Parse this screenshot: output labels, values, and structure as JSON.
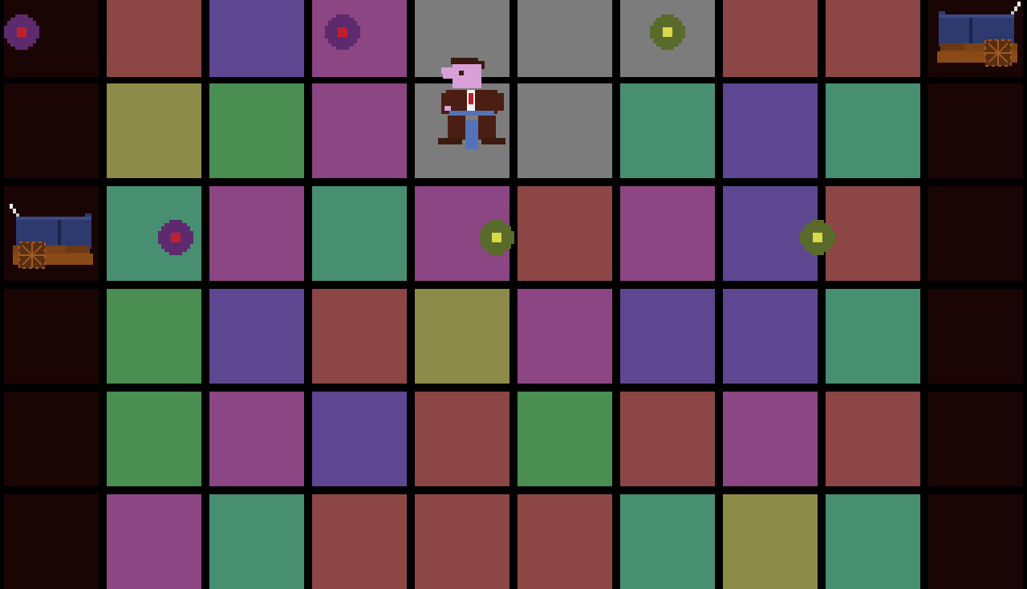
{
  "palette": {
    "R": "#8c4646",
    "P": "#5e4791",
    "M": "#8b4683",
    "Y": "#8d8b4a",
    "G": "#4a8e51",
    "T": "#488f72",
    "X": "#7c7c7c",
    "D": "#1a0505",
    "background": "#000000"
  },
  "grid": {
    "rows": [
      [
        "D",
        "R",
        "P",
        "M",
        "X",
        "X",
        "X",
        "R",
        "R",
        "D"
      ],
      [
        "D",
        "Y",
        "G",
        "M",
        "X",
        "X",
        "T",
        "P",
        "T",
        "D"
      ],
      [
        "D",
        "T",
        "M",
        "T",
        "M",
        "R",
        "M",
        "P",
        "R",
        "D"
      ],
      [
        "D",
        "G",
        "P",
        "R",
        "Y",
        "M",
        "P",
        "P",
        "T",
        "D"
      ],
      [
        "D",
        "G",
        "M",
        "P",
        "R",
        "G",
        "R",
        "M",
        "R",
        "D"
      ],
      [
        "D",
        "M",
        "T",
        "R",
        "R",
        "R",
        "T",
        "Y",
        "T",
        "D"
      ]
    ]
  },
  "targets": [
    {
      "row": 0,
      "col": 0,
      "ring": "#5e2a6e",
      "center": "#c0202e"
    },
    {
      "row": 0,
      "col": 3,
      "ring": "#5e2a6e",
      "center": "#c0202e"
    },
    {
      "row": 0,
      "col": 6,
      "ring": "#5a6a2a",
      "center": "#d8d84a"
    },
    {
      "row": 2,
      "col": 1,
      "ring": "#5e2a6e",
      "center": "#c0202e"
    },
    {
      "row": 2,
      "col": 4,
      "ring": "#5a6a2a",
      "center": "#d8d84a"
    },
    {
      "row": 2,
      "col": 7,
      "ring": "#5a6a2a",
      "center": "#d8d84a"
    }
  ],
  "cannons": [
    {
      "row": 0,
      "col": 9,
      "facing": "left"
    },
    {
      "row": 2,
      "col": 0,
      "facing": "right"
    }
  ],
  "player": {
    "row": 1,
    "col": 4,
    "icon": "man-in-suit-icon"
  }
}
